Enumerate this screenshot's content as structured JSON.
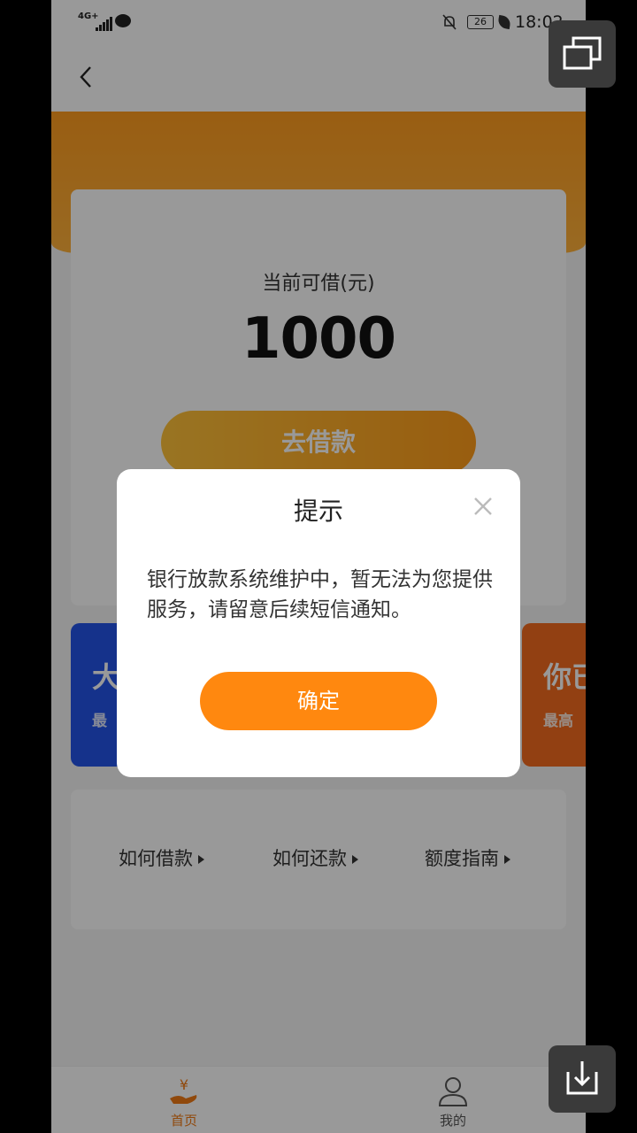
{
  "status_bar": {
    "network": "4G+",
    "battery": "26",
    "time": "18:02"
  },
  "nav": {
    "back_icon": "chevron-left-icon"
  },
  "loan_card": {
    "label": "当前可借(元)",
    "amount": "1000",
    "button_label": "去借款"
  },
  "promos": {
    "left_big": "大",
    "left_small": "最",
    "right_big": "你已",
    "right_small": "最高"
  },
  "guide": {
    "items": [
      "如何借款",
      "如何还款",
      "额度指南"
    ]
  },
  "tabs": {
    "home_label": "首页",
    "mine_label": "我的"
  },
  "dialog": {
    "title": "提示",
    "message": "银行放款系统维护中，暂无法为您提供服务，请留意后续短信通知。",
    "confirm_label": "确定"
  },
  "colors": {
    "brand_orange": "#ff880f",
    "promo_blue": "#2454e8",
    "promo_orange": "#f36b1e"
  }
}
